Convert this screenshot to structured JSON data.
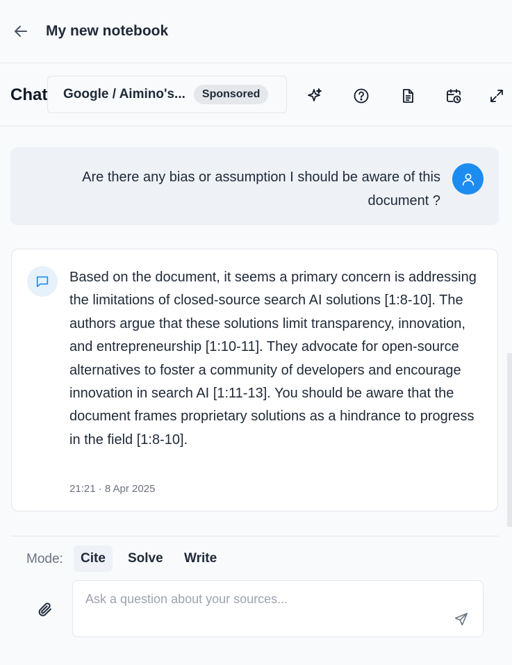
{
  "header": {
    "title": "My new notebook",
    "back_icon": "arrow-left-icon"
  },
  "chat_bar": {
    "label": "Chat",
    "model": "Google / Aimino's...",
    "badge": "Sponsored",
    "tools": [
      "sparkles-icon",
      "help-circle-icon",
      "document-icon",
      "calendar-clock-icon",
      "expand-icon"
    ]
  },
  "messages": {
    "user": {
      "text": "Are there any bias or assumption I should be aware of this document ?",
      "avatar_icon": "user-icon"
    },
    "assistant": {
      "text": "Based on the document, it seems a primary concern is addressing the limitations of closed-source search AI solutions [1:8-10]. The authors argue that these solutions limit transparency, innovation, and entrepreneurship [1:10-11]. They advocate for open-source alternatives to foster a community of developers and encourage innovation in search AI [1:11-13]. You should be aware that the document frames proprietary solutions as a hindrance to progress in the field [1:8-10].",
      "timestamp": "21:21 · 8 Apr 2025",
      "avatar_icon": "chat-bubble-icon"
    }
  },
  "composer": {
    "mode_label": "Mode:",
    "modes": [
      "Cite",
      "Solve",
      "Write"
    ],
    "selected_mode": "Cite",
    "placeholder": "Ask a question about your sources...",
    "value": ""
  },
  "colors": {
    "accent": "#1d8cf0",
    "user_bubble": "#eef2f7",
    "background": "#f8fafc"
  }
}
